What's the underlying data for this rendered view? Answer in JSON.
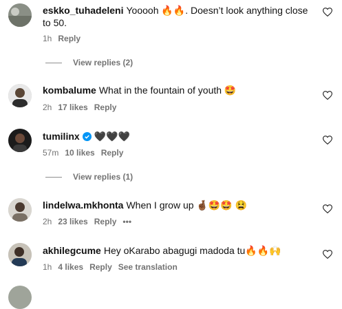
{
  "comments": [
    {
      "username": "eskko_tuhadeleni",
      "text": "Yooooh 🔥🔥. Doesn’t look anything close to 50.",
      "time": "1h",
      "likes": "",
      "reply_label": "Reply"
    },
    {
      "username": "kombalume",
      "text": "What in the fountain of youth 🤩",
      "time": "2h",
      "likes": "17 likes",
      "reply_label": "Reply"
    },
    {
      "username": "tumilinx",
      "text": "🖤🖤🖤",
      "time": "57m",
      "likes": "10 likes",
      "reply_label": "Reply"
    },
    {
      "username": "lindelwa.mkhonta",
      "text": "When I grow up 🤞🏾🤩🤩 😫",
      "time": "2h",
      "likes": "23 likes",
      "reply_label": "Reply",
      "more": "•••"
    },
    {
      "username": "akhilegcume",
      "text": "Hey oKarabo abagugi madoda tu🔥🔥🙌",
      "time": "1h",
      "likes": "4 likes",
      "reply_label": "Reply",
      "translation": "See translation"
    }
  ],
  "view_replies": [
    "View replies (2)",
    "View replies (1)"
  ],
  "icons": {
    "like": "heart-icon",
    "verified": "verified-badge-icon"
  }
}
